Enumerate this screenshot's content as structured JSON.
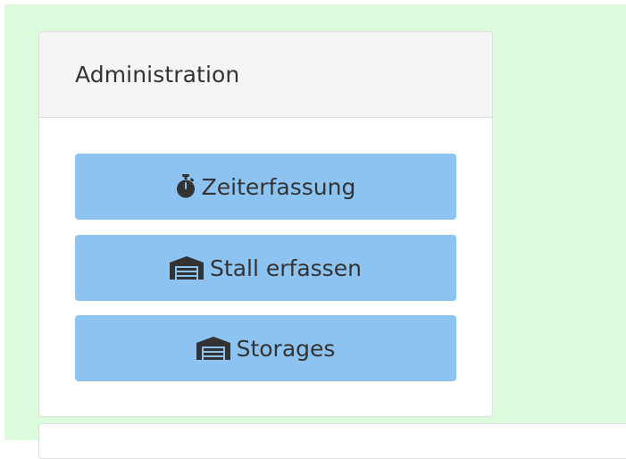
{
  "panel": {
    "title": "Administration"
  },
  "buttons": [
    {
      "label": "Zeiterfassung",
      "icon": "stopwatch-icon"
    },
    {
      "label": "Stall erfassen",
      "icon": "warehouse-icon"
    },
    {
      "label": "Storages",
      "icon": "warehouse-icon"
    }
  ],
  "colors": {
    "page_background": "#dcfadc",
    "button_background": "#8cc3f0",
    "panel_heading_background": "#f5f5f5",
    "text": "#333333"
  }
}
